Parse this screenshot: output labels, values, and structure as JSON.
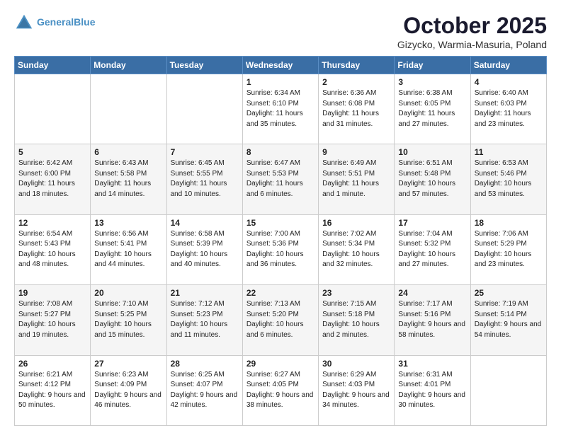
{
  "header": {
    "logo_line1": "General",
    "logo_line2": "Blue",
    "month": "October 2025",
    "location": "Gizycko, Warmia-Masuria, Poland"
  },
  "weekdays": [
    "Sunday",
    "Monday",
    "Tuesday",
    "Wednesday",
    "Thursday",
    "Friday",
    "Saturday"
  ],
  "weeks": [
    [
      {
        "day": "",
        "info": ""
      },
      {
        "day": "",
        "info": ""
      },
      {
        "day": "",
        "info": ""
      },
      {
        "day": "1",
        "info": "Sunrise: 6:34 AM\nSunset: 6:10 PM\nDaylight: 11 hours\nand 35 minutes."
      },
      {
        "day": "2",
        "info": "Sunrise: 6:36 AM\nSunset: 6:08 PM\nDaylight: 11 hours\nand 31 minutes."
      },
      {
        "day": "3",
        "info": "Sunrise: 6:38 AM\nSunset: 6:05 PM\nDaylight: 11 hours\nand 27 minutes."
      },
      {
        "day": "4",
        "info": "Sunrise: 6:40 AM\nSunset: 6:03 PM\nDaylight: 11 hours\nand 23 minutes."
      }
    ],
    [
      {
        "day": "5",
        "info": "Sunrise: 6:42 AM\nSunset: 6:00 PM\nDaylight: 11 hours\nand 18 minutes."
      },
      {
        "day": "6",
        "info": "Sunrise: 6:43 AM\nSunset: 5:58 PM\nDaylight: 11 hours\nand 14 minutes."
      },
      {
        "day": "7",
        "info": "Sunrise: 6:45 AM\nSunset: 5:55 PM\nDaylight: 11 hours\nand 10 minutes."
      },
      {
        "day": "8",
        "info": "Sunrise: 6:47 AM\nSunset: 5:53 PM\nDaylight: 11 hours\nand 6 minutes."
      },
      {
        "day": "9",
        "info": "Sunrise: 6:49 AM\nSunset: 5:51 PM\nDaylight: 11 hours\nand 1 minute."
      },
      {
        "day": "10",
        "info": "Sunrise: 6:51 AM\nSunset: 5:48 PM\nDaylight: 10 hours\nand 57 minutes."
      },
      {
        "day": "11",
        "info": "Sunrise: 6:53 AM\nSunset: 5:46 PM\nDaylight: 10 hours\nand 53 minutes."
      }
    ],
    [
      {
        "day": "12",
        "info": "Sunrise: 6:54 AM\nSunset: 5:43 PM\nDaylight: 10 hours\nand 48 minutes."
      },
      {
        "day": "13",
        "info": "Sunrise: 6:56 AM\nSunset: 5:41 PM\nDaylight: 10 hours\nand 44 minutes."
      },
      {
        "day": "14",
        "info": "Sunrise: 6:58 AM\nSunset: 5:39 PM\nDaylight: 10 hours\nand 40 minutes."
      },
      {
        "day": "15",
        "info": "Sunrise: 7:00 AM\nSunset: 5:36 PM\nDaylight: 10 hours\nand 36 minutes."
      },
      {
        "day": "16",
        "info": "Sunrise: 7:02 AM\nSunset: 5:34 PM\nDaylight: 10 hours\nand 32 minutes."
      },
      {
        "day": "17",
        "info": "Sunrise: 7:04 AM\nSunset: 5:32 PM\nDaylight: 10 hours\nand 27 minutes."
      },
      {
        "day": "18",
        "info": "Sunrise: 7:06 AM\nSunset: 5:29 PM\nDaylight: 10 hours\nand 23 minutes."
      }
    ],
    [
      {
        "day": "19",
        "info": "Sunrise: 7:08 AM\nSunset: 5:27 PM\nDaylight: 10 hours\nand 19 minutes."
      },
      {
        "day": "20",
        "info": "Sunrise: 7:10 AM\nSunset: 5:25 PM\nDaylight: 10 hours\nand 15 minutes."
      },
      {
        "day": "21",
        "info": "Sunrise: 7:12 AM\nSunset: 5:23 PM\nDaylight: 10 hours\nand 11 minutes."
      },
      {
        "day": "22",
        "info": "Sunrise: 7:13 AM\nSunset: 5:20 PM\nDaylight: 10 hours\nand 6 minutes."
      },
      {
        "day": "23",
        "info": "Sunrise: 7:15 AM\nSunset: 5:18 PM\nDaylight: 10 hours\nand 2 minutes."
      },
      {
        "day": "24",
        "info": "Sunrise: 7:17 AM\nSunset: 5:16 PM\nDaylight: 9 hours\nand 58 minutes."
      },
      {
        "day": "25",
        "info": "Sunrise: 7:19 AM\nSunset: 5:14 PM\nDaylight: 9 hours\nand 54 minutes."
      }
    ],
    [
      {
        "day": "26",
        "info": "Sunrise: 6:21 AM\nSunset: 4:12 PM\nDaylight: 9 hours\nand 50 minutes."
      },
      {
        "day": "27",
        "info": "Sunrise: 6:23 AM\nSunset: 4:09 PM\nDaylight: 9 hours\nand 46 minutes."
      },
      {
        "day": "28",
        "info": "Sunrise: 6:25 AM\nSunset: 4:07 PM\nDaylight: 9 hours\nand 42 minutes."
      },
      {
        "day": "29",
        "info": "Sunrise: 6:27 AM\nSunset: 4:05 PM\nDaylight: 9 hours\nand 38 minutes."
      },
      {
        "day": "30",
        "info": "Sunrise: 6:29 AM\nSunset: 4:03 PM\nDaylight: 9 hours\nand 34 minutes."
      },
      {
        "day": "31",
        "info": "Sunrise: 6:31 AM\nSunset: 4:01 PM\nDaylight: 9 hours\nand 30 minutes."
      },
      {
        "day": "",
        "info": ""
      }
    ]
  ]
}
